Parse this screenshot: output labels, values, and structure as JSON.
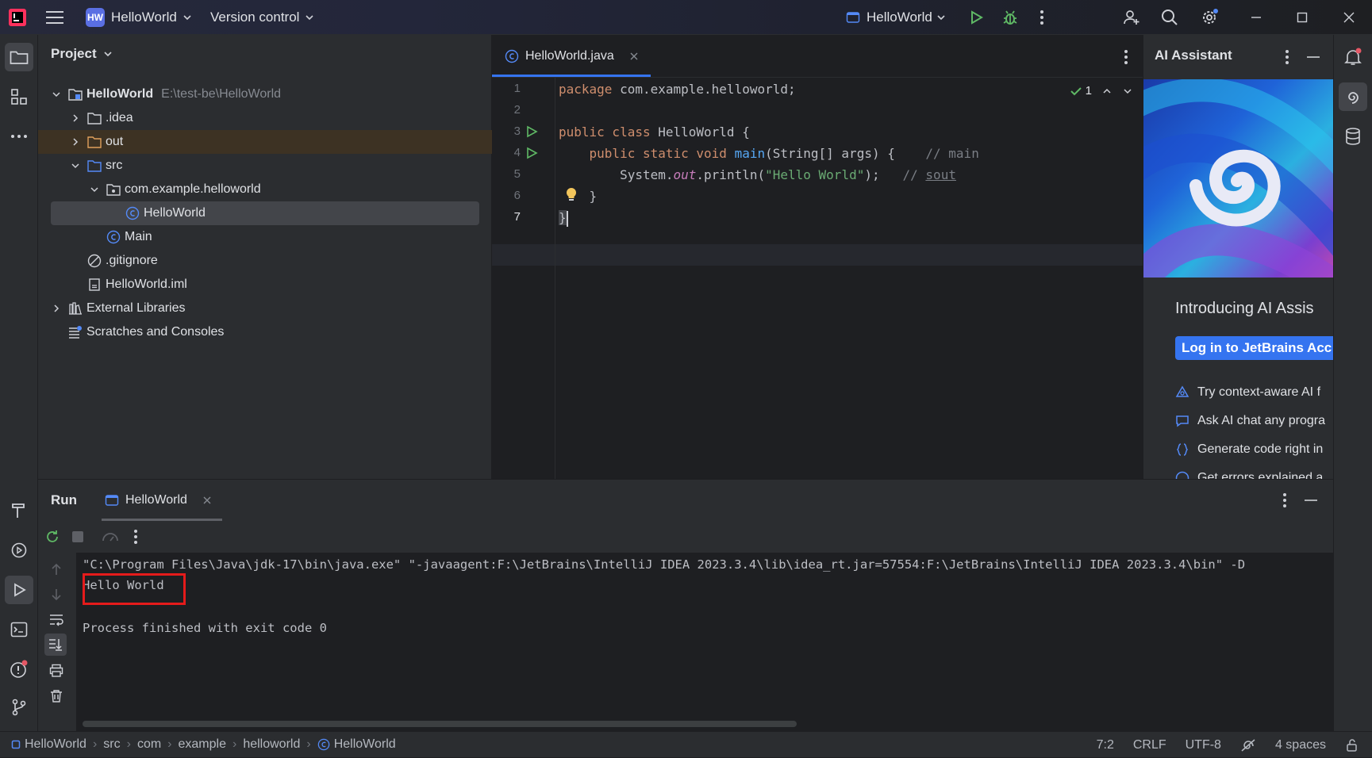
{
  "titlebar": {
    "project_badge": "HW",
    "project_name": "HelloWorld",
    "vcs_label": "Version control",
    "run_config": "HelloWorld"
  },
  "project_panel": {
    "title": "Project",
    "tree": [
      {
        "label": "HelloWorld",
        "extra": "E:\\test-be\\HelloWorld",
        "level": 0,
        "type": "module"
      },
      {
        "label": ".idea",
        "level": 1,
        "type": "folder"
      },
      {
        "label": "out",
        "level": 1,
        "type": "folder-excluded"
      },
      {
        "label": "src",
        "level": 1,
        "type": "folder-source"
      },
      {
        "label": "com.example.helloworld",
        "level": 2,
        "type": "package"
      },
      {
        "label": "HelloWorld",
        "level": 3,
        "type": "class"
      },
      {
        "label": "Main",
        "level": 2,
        "type": "class"
      },
      {
        "label": ".gitignore",
        "level": 1,
        "type": "ignore"
      },
      {
        "label": "HelloWorld.iml",
        "level": 1,
        "type": "iml"
      },
      {
        "label": "External Libraries",
        "level": 0,
        "type": "libraries"
      },
      {
        "label": "Scratches and Consoles",
        "level": 0,
        "type": "scratches"
      }
    ]
  },
  "editor": {
    "tab_label": "HelloWorld.java",
    "inspection_count": "1",
    "line_numbers": [
      "1",
      "2",
      "3",
      "4",
      "5",
      "6",
      "7"
    ],
    "code": {
      "l1_kw": "package",
      "l1_rest": " com.example.helloworld;",
      "l3_kw": "public class",
      "l3_rest": " HelloWorld {",
      "l4_kw": "public static void",
      "l4_fn": "main",
      "l4_rest": "(String[] args) {",
      "l4_cmt": "// main",
      "l5_a": "System.",
      "l5_field": "out",
      "l5_b": ".println(",
      "l5_str": "\"Hello World\"",
      "l5_c": ");",
      "l5_cmt": "// ",
      "l5_cmt_u": "sout",
      "l6": "}",
      "l7": "}"
    }
  },
  "ai_panel": {
    "title": "AI Assistant",
    "intro": "Introducing AI Assis",
    "login_button": "Log in to JetBrains Acc",
    "features": [
      "Try context-aware AI f",
      "Ask AI chat any progra",
      "Generate code right in",
      "Get errors explained a"
    ]
  },
  "run_panel": {
    "label": "Run",
    "tab_label": "HelloWorld",
    "console": {
      "command": "\"C:\\Program Files\\Java\\jdk-17\\bin\\java.exe\" \"-javaagent:F:\\JetBrains\\IntelliJ IDEA 2023.3.4\\lib\\idea_rt.jar=57554:F:\\JetBrains\\IntelliJ IDEA 2023.3.4\\bin\" -D",
      "output": "Hello World",
      "exit": "Process finished with exit code 0"
    }
  },
  "status_bar": {
    "breadcrumbs": [
      "HelloWorld",
      "src",
      "com",
      "example",
      "helloworld",
      "HelloWorld"
    ],
    "position": "7:2",
    "line_sep": "CRLF",
    "encoding": "UTF-8",
    "indent": "4 spaces"
  },
  "colors": {
    "accent": "#3574f0",
    "run_green": "#5fb865",
    "highlight_box": "#e51b1b"
  }
}
